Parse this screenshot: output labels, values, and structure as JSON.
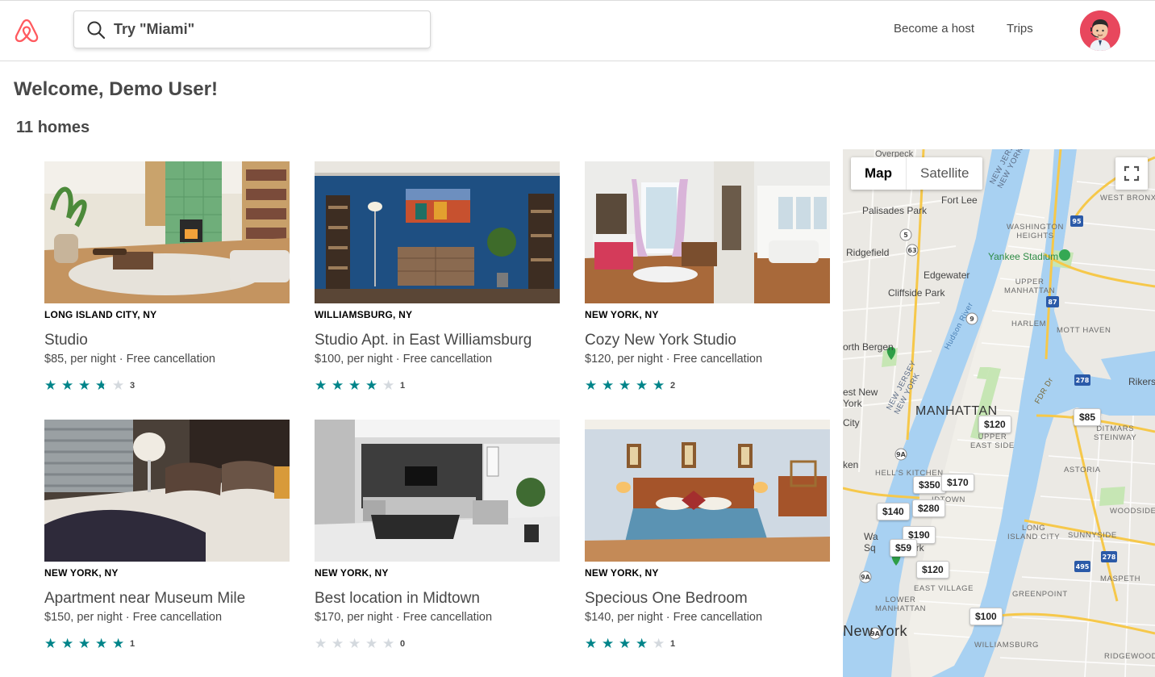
{
  "header": {
    "search_placeholder": "Try \"Miami\"",
    "become_host_label": "Become a host",
    "trips_label": "Trips",
    "brand_color": "#FF5A5F"
  },
  "welcome_text": "Welcome, Demo User!",
  "homes_count_text": "11 homes",
  "listings": [
    {
      "location": "LONG ISLAND CITY, NY",
      "title": "Studio",
      "subtitle": "$85, per night · Free cancellation",
      "rating": 3.5,
      "review_count": "3"
    },
    {
      "location": "WILLIAMSBURG, NY",
      "title": "Studio Apt. in East Williamsburg",
      "subtitle": "$100, per night · Free cancellation",
      "rating": 4,
      "review_count": "1"
    },
    {
      "location": "NEW YORK, NY",
      "title": "Cozy New York Studio",
      "subtitle": "$120, per night · Free cancellation",
      "rating": 5,
      "review_count": "2"
    },
    {
      "location": "NEW YORK, NY",
      "title": "Apartment near Museum Mile",
      "subtitle": "$150, per night · Free cancellation",
      "rating": 5,
      "review_count": "1"
    },
    {
      "location": "NEW YORK, NY",
      "title": "Best location in Midtown",
      "subtitle": "$170, per night · Free cancellation",
      "rating": 0,
      "review_count": "0"
    },
    {
      "location": "NEW YORK, NY",
      "title": "Specious One Bedroom",
      "subtitle": "$140, per night · Free cancellation",
      "rating": 4,
      "review_count": "1"
    }
  ],
  "star_color": "#008489",
  "map": {
    "map_label": "Map",
    "satellite_label": "Satellite",
    "price_pins": [
      "$120",
      "$85",
      "$350",
      "$170",
      "$280",
      "$140",
      "$190",
      "$59",
      "$120",
      "$100"
    ],
    "place_labels": {
      "overpeck": "Overpeck",
      "fort_lee": "Fort Lee",
      "palisades_park": "Palisades Park",
      "ridgefield": "Ridgefield",
      "edgewater": "Edgewater",
      "cliffside_park": "Cliffside Park",
      "north_bergen": "orth Bergen",
      "west_new_york": "est New\nYork",
      "city": "City",
      "ken": "ken",
      "manhattan": "MANHATTAN",
      "new_york": "New York",
      "yankee_stadium": "Yankee Stadium",
      "west_bronx": "WEST BRONX",
      "washington_heights": "WASHINGTON\nHEIGHTS",
      "upper_manhattan": "UPPER\nMANHATTAN",
      "harlem": "HARLEM",
      "mott_haven": "MOTT HAVEN",
      "rikers": "Rikers",
      "ditmars_steinway": "DITMARS\nSTEINWAY",
      "upper_east_side": "UPPER\nEAST SIDE",
      "astoria": "ASTORIA",
      "hells_kitchen": "HELL'S KITCHEN",
      "midtown": "IDTOWN",
      "woodside": "WOODSIDE",
      "long_island_city": "LONG\nISLAND CITY",
      "sunnyside": "SUNNYSIDE",
      "maspeth": "MASPETH",
      "east_village": "EAST VILLAGE",
      "greenpoint": "GREENPOINT",
      "lower_manhattan": "LOWER\nMANHATTAN",
      "williamsburg": "WILLIAMSBURG",
      "ridgewood": "RIDGEWOOD",
      "new_jersey": "NEW JERSEY\nNEW YORK",
      "hudson_river": "Hudson River",
      "fdr_dr": "FDR Dr",
      "washington_sq": "Wa\nSq",
      "park": "ark"
    },
    "route_shields": [
      "95",
      "87",
      "278",
      "495",
      "278",
      "9",
      "5",
      "63",
      "9A",
      "9A",
      "9A"
    ]
  }
}
